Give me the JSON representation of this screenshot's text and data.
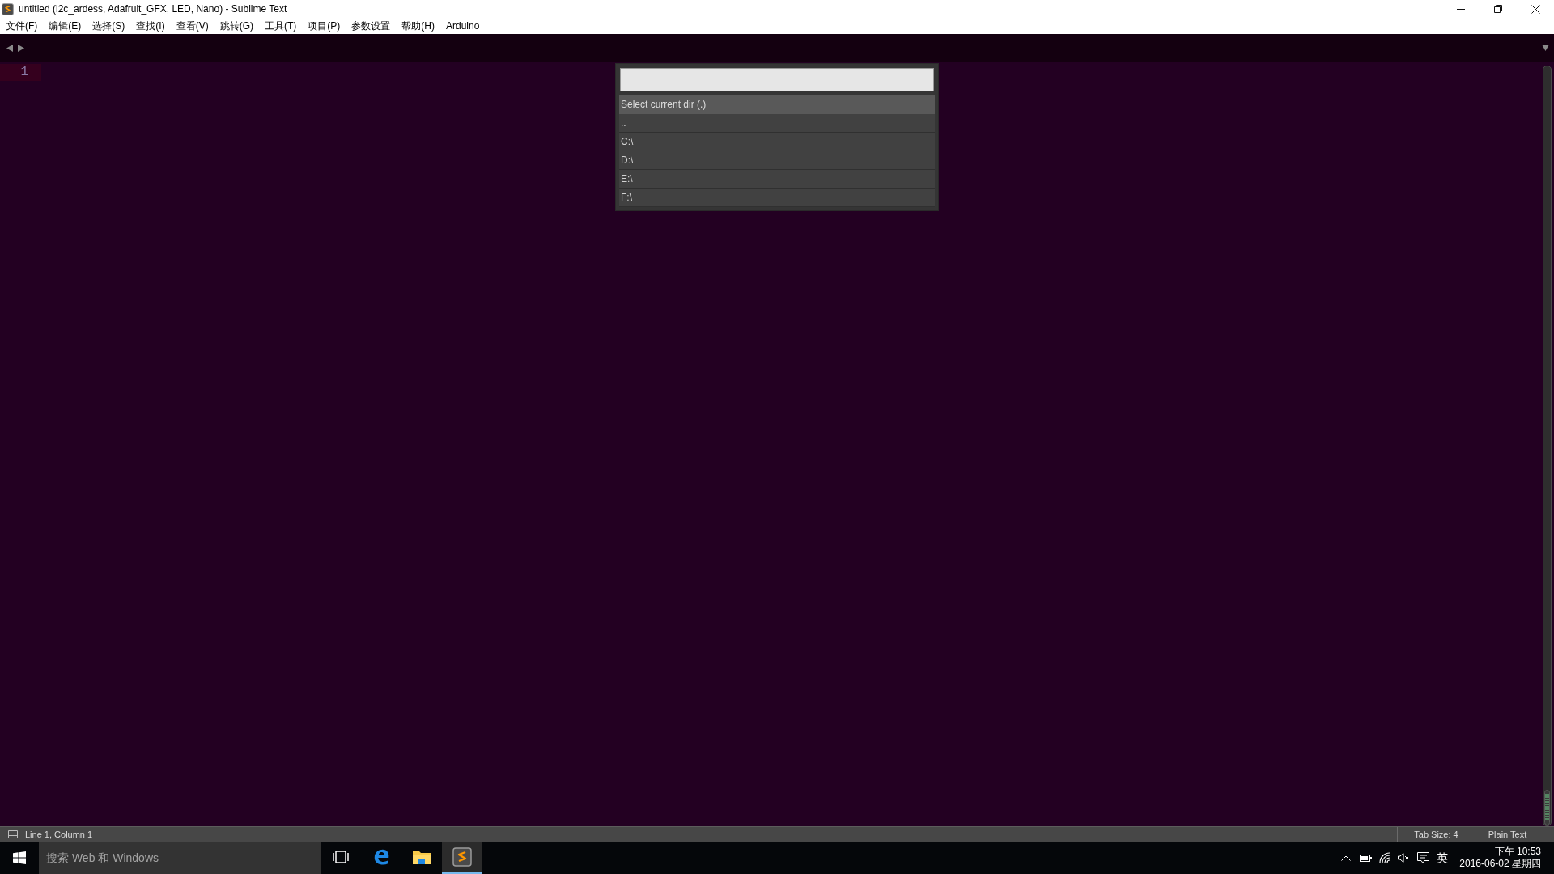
{
  "window": {
    "title": "untitled (i2c_ardess, Adafruit_GFX, LED, Nano) - Sublime Text"
  },
  "menu": [
    "文件(F)",
    "编辑(E)",
    "选择(S)",
    "查找(I)",
    "查看(V)",
    "跳转(G)",
    "工具(T)",
    "项目(P)",
    "参数设置",
    "帮助(H)",
    "Arduino"
  ],
  "editor": {
    "lines": [
      {
        "number": "1",
        "current": true
      }
    ]
  },
  "quick_panel": {
    "items": [
      {
        "label": "Select current dir (.)",
        "selected": true
      },
      {
        "label": "..",
        "selected": false
      },
      {
        "label": "C:\\",
        "selected": false
      },
      {
        "label": "D:\\",
        "selected": false
      },
      {
        "label": "E:\\",
        "selected": false
      },
      {
        "label": "F:\\",
        "selected": false
      }
    ]
  },
  "status_bar": {
    "position": "Line 1, Column 1",
    "tab_size": "Tab Size: 4",
    "syntax": "Plain Text"
  },
  "taskbar": {
    "search": {
      "placeholder": "搜索 Web 和 Windows"
    },
    "apps": [
      {
        "kind": "taskview",
        "active": false
      },
      {
        "kind": "browser",
        "active": false
      },
      {
        "kind": "folder",
        "active": false
      },
      {
        "kind": "editor",
        "active": true
      }
    ],
    "tray": {
      "input_method": "英",
      "time": "下午 10:53",
      "date": "2016-06-02 星期四"
    }
  }
}
